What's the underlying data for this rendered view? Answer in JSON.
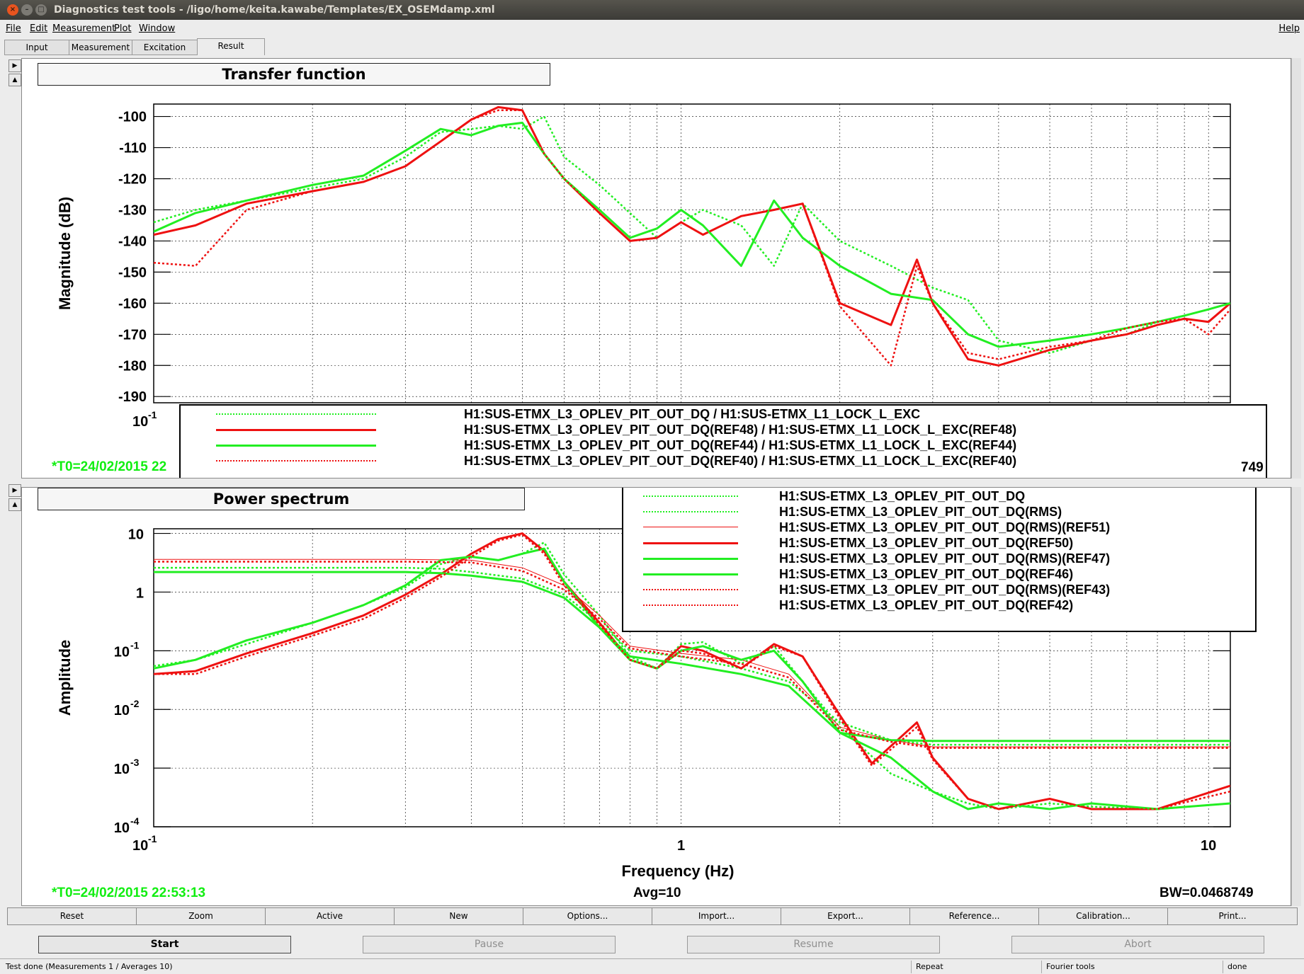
{
  "window": {
    "title": "Diagnostics test tools - /ligo/home/keita.kawabe/Templates/EX_OSEMdamp.xml"
  },
  "menu": {
    "file": "File",
    "edit": "Edit",
    "measurement": "Measurement",
    "plot": "Plot",
    "window": "Window",
    "help": "Help"
  },
  "tabs": [
    "Input",
    "Measurement",
    "Excitation",
    "Result"
  ],
  "colors": {
    "green": "#22ee22",
    "red": "#ee1111",
    "t0_text": "#11ee11"
  },
  "transfer_function": {
    "title": "Transfer function",
    "ylabel": "Magnitude (dB)",
    "xtick_first": "10",
    "xtick_first_exp": "-1",
    "t0": "*T0=24/02/2015 22",
    "bw_fragment": "749",
    "legend": [
      {
        "label": "H1:SUS-ETMX_L3_OPLEV_PIT_OUT_DQ / H1:SUS-ETMX_L1_LOCK_L_EXC",
        "color": "green",
        "style": "dotted"
      },
      {
        "label": "H1:SUS-ETMX_L3_OPLEV_PIT_OUT_DQ(REF48) / H1:SUS-ETMX_L1_LOCK_L_EXC(REF48)",
        "color": "red",
        "style": "solid"
      },
      {
        "label": "H1:SUS-ETMX_L3_OPLEV_PIT_OUT_DQ(REF44) / H1:SUS-ETMX_L1_LOCK_L_EXC(REF44)",
        "color": "green",
        "style": "solid"
      },
      {
        "label": "H1:SUS-ETMX_L3_OPLEV_PIT_OUT_DQ(REF40) / H1:SUS-ETMX_L1_LOCK_L_EXC(REF40)",
        "color": "red",
        "style": "dotted"
      }
    ]
  },
  "power_spectrum": {
    "title": "Power spectrum",
    "ylabel": "Amplitude",
    "xlabel": "Frequency (Hz)",
    "t0": "*T0=24/02/2015 22:53:13",
    "avg": "Avg=10",
    "bw": "BW=0.0468749",
    "legend": [
      {
        "label": "H1:SUS-ETMX_L3_OPLEV_PIT_OUT_DQ",
        "color": "green",
        "style": "dotted"
      },
      {
        "label": "H1:SUS-ETMX_L3_OPLEV_PIT_OUT_DQ(RMS)",
        "color": "green",
        "style": "dotted"
      },
      {
        "label": "H1:SUS-ETMX_L3_OPLEV_PIT_OUT_DQ(RMS)(REF51)",
        "color": "red",
        "style": "thin"
      },
      {
        "label": "H1:SUS-ETMX_L3_OPLEV_PIT_OUT_DQ(REF50)",
        "color": "red",
        "style": "solid"
      },
      {
        "label": "H1:SUS-ETMX_L3_OPLEV_PIT_OUT_DQ(RMS)(REF47)",
        "color": "green",
        "style": "solid"
      },
      {
        "label": "H1:SUS-ETMX_L3_OPLEV_PIT_OUT_DQ(REF46)",
        "color": "green",
        "style": "solid"
      },
      {
        "label": "H1:SUS-ETMX_L3_OPLEV_PIT_OUT_DQ(RMS)(REF43)",
        "color": "red",
        "style": "dotted"
      },
      {
        "label": "H1:SUS-ETMX_L3_OPLEV_PIT_OUT_DQ(REF42)",
        "color": "red",
        "style": "dotted"
      }
    ]
  },
  "chart_data": [
    {
      "type": "line",
      "title": "Transfer function",
      "xlabel": "",
      "ylabel": "Magnitude (dB)",
      "xscale": "log",
      "xlim": [
        0.1,
        11
      ],
      "ylim": [
        -192,
        -96
      ],
      "yticks": [
        -100,
        -110,
        -120,
        -130,
        -140,
        -150,
        -160,
        -170,
        -180,
        -190
      ],
      "xticks": [
        "10^-1"
      ],
      "grid": true,
      "series": [
        {
          "name": "H1:SUS-ETMX_L3_OPLEV_PIT_OUT_DQ / H1:SUS-ETMX_L1_LOCK_L_EXC",
          "color": "green",
          "style": "dotted",
          "x": [
            0.1,
            0.12,
            0.15,
            0.2,
            0.25,
            0.3,
            0.35,
            0.4,
            0.45,
            0.5,
            0.55,
            0.6,
            0.7,
            0.8,
            0.9,
            1.0,
            1.1,
            1.3,
            1.5,
            1.7,
            2.0,
            2.5,
            3.0,
            3.5,
            4.0,
            5.0,
            6.0,
            7.0,
            8.0,
            9.0,
            10.0,
            11.0
          ],
          "y": [
            -134,
            -130,
            -127,
            -123,
            -120,
            -113,
            -105,
            -104,
            -103,
            -104,
            -100,
            -113,
            -122,
            -131,
            -139,
            -134,
            -130,
            -135,
            -148,
            -128,
            -140,
            -148,
            -155,
            -159,
            -172,
            -176,
            -172,
            -170,
            -166,
            -164,
            -162,
            -160
          ]
        },
        {
          "name": "H1:SUS-ETMX_L3_OPLEV_PIT_OUT_DQ(REF48) / H1:SUS-ETMX_L1_LOCK_L_EXC(REF48)",
          "color": "red",
          "style": "solid",
          "x": [
            0.1,
            0.12,
            0.15,
            0.2,
            0.25,
            0.3,
            0.35,
            0.4,
            0.45,
            0.5,
            0.55,
            0.6,
            0.7,
            0.8,
            0.9,
            1.0,
            1.1,
            1.3,
            1.5,
            1.7,
            2.0,
            2.5,
            2.8,
            3.0,
            3.5,
            4.0,
            5.0,
            6.0,
            7.0,
            8.0,
            9.0,
            10.0,
            11.0
          ],
          "y": [
            -138,
            -135,
            -128,
            -124,
            -121,
            -116,
            -108,
            -101,
            -97,
            -98,
            -112,
            -120,
            -131,
            -140,
            -139,
            -134,
            -138,
            -132,
            -130,
            -128,
            -160,
            -167,
            -146,
            -160,
            -178,
            -180,
            -175,
            -172,
            -170,
            -167,
            -165,
            -166,
            -160
          ]
        },
        {
          "name": "H1:SUS-ETMX_L3_OPLEV_PIT_OUT_DQ(REF44) / H1:SUS-ETMX_L1_LOCK_L_EXC(REF44)",
          "color": "green",
          "style": "solid",
          "x": [
            0.1,
            0.12,
            0.15,
            0.2,
            0.25,
            0.3,
            0.35,
            0.4,
            0.45,
            0.5,
            0.55,
            0.6,
            0.7,
            0.8,
            0.9,
            1.0,
            1.1,
            1.3,
            1.5,
            1.7,
            2.0,
            2.5,
            3.0,
            3.5,
            4.0,
            5.0,
            6.0,
            7.0,
            8.0,
            9.0,
            10.0,
            11.0
          ],
          "y": [
            -137,
            -131,
            -127,
            -122,
            -119,
            -111,
            -104,
            -106,
            -103,
            -102,
            -112,
            -120,
            -130,
            -139,
            -136,
            -130,
            -135,
            -148,
            -127,
            -139,
            -148,
            -157,
            -159,
            -170,
            -174,
            -172,
            -170,
            -168,
            -166,
            -164,
            -162,
            -160
          ]
        },
        {
          "name": "H1:SUS-ETMX_L3_OPLEV_PIT_OUT_DQ(REF40) / H1:SUS-ETMX_L1_LOCK_L_EXC(REF40)",
          "color": "red",
          "style": "dotted",
          "x": [
            0.1,
            0.12,
            0.15,
            0.2,
            0.25,
            0.3,
            0.35,
            0.4,
            0.45,
            0.5,
            0.55,
            0.6,
            0.7,
            0.8,
            0.9,
            1.0,
            1.1,
            1.3,
            1.5,
            1.7,
            2.0,
            2.5,
            2.8,
            3.0,
            3.5,
            4.0,
            5.0,
            6.0,
            7.0,
            8.0,
            9.0,
            10.0,
            11.0
          ],
          "y": [
            -147,
            -148,
            -130,
            -124,
            -121,
            -116,
            -108,
            -101,
            -98,
            -98,
            -112,
            -120,
            -131,
            -140,
            -139,
            -134,
            -138,
            -132,
            -130,
            -128,
            -161,
            -180,
            -148,
            -160,
            -176,
            -178,
            -174,
            -172,
            -168,
            -166,
            -165,
            -170,
            -162
          ]
        }
      ]
    },
    {
      "type": "line",
      "title": "Power spectrum",
      "xlabel": "Frequency (Hz)",
      "ylabel": "Amplitude",
      "xscale": "log",
      "yscale": "log",
      "xlim": [
        0.1,
        11
      ],
      "ylim": [
        0.0001,
        12
      ],
      "xticks": [
        "10^-1",
        "1",
        "10"
      ],
      "yticks": [
        "10",
        "1",
        "10^-1",
        "10^-2",
        "10^-3",
        "10^-4"
      ],
      "grid": true,
      "series": [
        {
          "name": "H1:SUS-ETMX_L3_OPLEV_PIT_OUT_DQ",
          "color": "green",
          "style": "dotted",
          "x": [
            0.1,
            0.12,
            0.15,
            0.2,
            0.25,
            0.3,
            0.35,
            0.4,
            0.45,
            0.5,
            0.55,
            0.6,
            0.7,
            0.8,
            0.9,
            1.0,
            1.1,
            1.3,
            1.5,
            1.7,
            2.0,
            2.5,
            3.0,
            3.5,
            4.0,
            5.0,
            6.0,
            8.0,
            11.0
          ],
          "y": [
            0.055,
            0.07,
            0.13,
            0.3,
            0.6,
            1.2,
            3.0,
            4.0,
            3.5,
            4.5,
            7.0,
            2.0,
            0.4,
            0.08,
            0.05,
            0.13,
            0.14,
            0.06,
            0.12,
            0.03,
            0.005,
            0.0008,
            0.0004,
            0.00025,
            0.0002,
            0.00025,
            0.00022,
            0.0002,
            0.00025
          ]
        },
        {
          "name": "H1:SUS-ETMX_L3_OPLEV_PIT_OUT_DQ(RMS)",
          "color": "green",
          "style": "dotted",
          "x": [
            0.1,
            0.2,
            0.3,
            0.35,
            0.4,
            0.5,
            0.6,
            0.7,
            0.8,
            1.0,
            1.3,
            1.6,
            2.0,
            2.5,
            3.0,
            11.0
          ],
          "y": [
            2.6,
            2.6,
            2.6,
            2.5,
            2.2,
            1.7,
            0.9,
            0.3,
            0.1,
            0.08,
            0.05,
            0.03,
            0.006,
            0.003,
            0.0025,
            0.0025
          ]
        },
        {
          "name": "H1:SUS-ETMX_L3_OPLEV_PIT_OUT_DQ(RMS)(REF51)",
          "color": "red",
          "style": "thin",
          "x": [
            0.1,
            0.3,
            0.4,
            0.5,
            0.6,
            0.7,
            0.8,
            1.0,
            1.3,
            1.6,
            2.0,
            2.5,
            3.0,
            11.0
          ],
          "y": [
            3.6,
            3.6,
            3.5,
            2.6,
            1.3,
            0.4,
            0.12,
            0.09,
            0.07,
            0.04,
            0.005,
            0.003,
            0.0023,
            0.0023
          ]
        },
        {
          "name": "H1:SUS-ETMX_L3_OPLEV_PIT_OUT_DQ(REF50)",
          "color": "red",
          "style": "solid",
          "x": [
            0.1,
            0.12,
            0.15,
            0.2,
            0.25,
            0.3,
            0.35,
            0.4,
            0.45,
            0.5,
            0.55,
            0.6,
            0.7,
            0.8,
            0.9,
            1.0,
            1.1,
            1.3,
            1.5,
            1.7,
            2.0,
            2.3,
            2.8,
            3.0,
            3.5,
            4.0,
            5.0,
            6.0,
            8.0,
            11.0
          ],
          "y": [
            0.04,
            0.045,
            0.09,
            0.2,
            0.4,
            0.9,
            2.0,
            4.5,
            8.0,
            10.0,
            5.0,
            1.5,
            0.3,
            0.07,
            0.05,
            0.12,
            0.1,
            0.05,
            0.13,
            0.08,
            0.008,
            0.0012,
            0.006,
            0.0015,
            0.0003,
            0.0002,
            0.0003,
            0.0002,
            0.0002,
            0.0005
          ]
        },
        {
          "name": "H1:SUS-ETMX_L3_OPLEV_PIT_OUT_DQ(RMS)(REF47)",
          "color": "green",
          "style": "solid",
          "x": [
            0.1,
            0.2,
            0.3,
            0.35,
            0.4,
            0.5,
            0.6,
            0.7,
            0.8,
            1.0,
            1.3,
            1.6,
            2.0,
            2.5,
            3.0,
            11.0
          ],
          "y": [
            2.2,
            2.2,
            2.2,
            2.1,
            1.9,
            1.5,
            0.8,
            0.25,
            0.08,
            0.06,
            0.04,
            0.025,
            0.004,
            0.003,
            0.0029,
            0.0029
          ]
        },
        {
          "name": "H1:SUS-ETMX_L3_OPLEV_PIT_OUT_DQ(REF46)",
          "color": "green",
          "style": "solid",
          "x": [
            0.1,
            0.12,
            0.15,
            0.2,
            0.25,
            0.3,
            0.35,
            0.4,
            0.45,
            0.5,
            0.55,
            0.6,
            0.7,
            0.8,
            0.9,
            1.0,
            1.1,
            1.3,
            1.5,
            1.7,
            2.0,
            2.5,
            3.0,
            3.5,
            4.0,
            5.0,
            6.0,
            8.0,
            11.0
          ],
          "y": [
            0.05,
            0.07,
            0.15,
            0.3,
            0.6,
            1.3,
            3.5,
            4.0,
            3.5,
            4.5,
            5.5,
            1.5,
            0.25,
            0.07,
            0.05,
            0.1,
            0.12,
            0.07,
            0.1,
            0.03,
            0.004,
            0.0015,
            0.0004,
            0.0002,
            0.00025,
            0.0002,
            0.00025,
            0.0002,
            0.00025
          ]
        },
        {
          "name": "H1:SUS-ETMX_L3_OPLEV_PIT_OUT_DQ(RMS)(REF43)",
          "color": "red",
          "style": "dotted",
          "x": [
            0.1,
            0.3,
            0.4,
            0.5,
            0.6,
            0.7,
            0.8,
            1.0,
            1.3,
            1.6,
            2.0,
            2.5,
            3.0,
            11.0
          ],
          "y": [
            3.3,
            3.3,
            3.2,
            2.3,
            1.1,
            0.35,
            0.11,
            0.08,
            0.06,
            0.035,
            0.0045,
            0.0028,
            0.0022,
            0.0022
          ]
        },
        {
          "name": "H1:SUS-ETMX_L3_OPLEV_PIT_OUT_DQ(REF42)",
          "color": "red",
          "style": "dotted",
          "x": [
            0.1,
            0.12,
            0.15,
            0.2,
            0.25,
            0.3,
            0.35,
            0.4,
            0.45,
            0.5,
            0.55,
            0.6,
            0.7,
            0.8,
            0.9,
            1.0,
            1.1,
            1.3,
            1.5,
            1.7,
            2.0,
            2.3,
            2.8,
            3.0,
            3.5,
            4.0,
            5.0,
            6.0,
            8.0,
            11.0
          ],
          "y": [
            0.04,
            0.04,
            0.08,
            0.18,
            0.35,
            0.8,
            1.8,
            4.0,
            7.5,
            9.5,
            4.5,
            1.3,
            0.28,
            0.07,
            0.05,
            0.1,
            0.09,
            0.05,
            0.12,
            0.08,
            0.007,
            0.0011,
            0.005,
            0.0014,
            0.0003,
            0.0002,
            0.0003,
            0.0002,
            0.0002,
            0.0004
          ]
        }
      ]
    }
  ],
  "toolbar": [
    "Reset",
    "Zoom",
    "Active",
    "New",
    "Options...",
    "Import...",
    "Export...",
    "Reference...",
    "Calibration...",
    "Print..."
  ],
  "controls": {
    "start": "Start",
    "pause": "Pause",
    "resume": "Resume",
    "abort": "Abort"
  },
  "status": {
    "message": "Test done (Measurements 1 / Averages 10)",
    "repeat": "Repeat",
    "tool": "Fourier tools",
    "state": "done"
  }
}
